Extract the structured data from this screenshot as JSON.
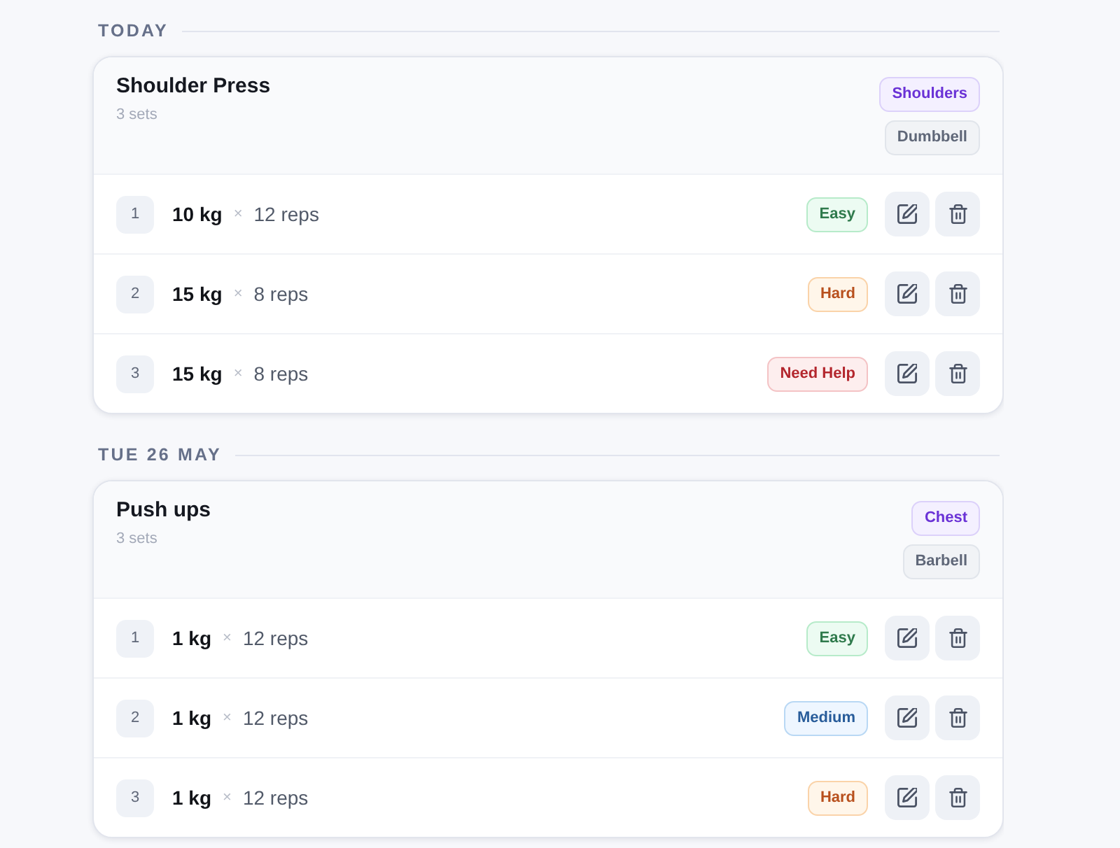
{
  "sections": [
    {
      "label": "TODAY",
      "exercises": [
        {
          "name": "Shoulder Press",
          "subtitle": "3 sets",
          "tags": [
            {
              "text": "Shoulders",
              "kind": "muscle"
            },
            {
              "text": "Dumbbell",
              "kind": "equipment"
            }
          ],
          "sets": [
            {
              "number": "1",
              "weight": "10 kg",
              "times": "×",
              "reps": "12 reps",
              "difficulty": {
                "text": "Easy",
                "kind": "easy"
              }
            },
            {
              "number": "2",
              "weight": "15 kg",
              "times": "×",
              "reps": "8 reps",
              "difficulty": {
                "text": "Hard",
                "kind": "hard"
              }
            },
            {
              "number": "3",
              "weight": "15 kg",
              "times": "×",
              "reps": "8 reps",
              "difficulty": {
                "text": "Need Help",
                "kind": "help"
              }
            }
          ]
        }
      ]
    },
    {
      "label": "TUE 26 MAY",
      "exercises": [
        {
          "name": "Push ups",
          "subtitle": "3 sets",
          "tags": [
            {
              "text": "Chest",
              "kind": "muscle"
            },
            {
              "text": "Barbell",
              "kind": "equipment"
            }
          ],
          "sets": [
            {
              "number": "1",
              "weight": "1 kg",
              "times": "×",
              "reps": "12 reps",
              "difficulty": {
                "text": "Easy",
                "kind": "easy"
              }
            },
            {
              "number": "2",
              "weight": "1 kg",
              "times": "×",
              "reps": "12 reps",
              "difficulty": {
                "text": "Medium",
                "kind": "medium"
              }
            },
            {
              "number": "3",
              "weight": "1 kg",
              "times": "×",
              "reps": "12 reps",
              "difficulty": {
                "text": "Hard",
                "kind": "hard"
              }
            }
          ]
        }
      ]
    }
  ]
}
